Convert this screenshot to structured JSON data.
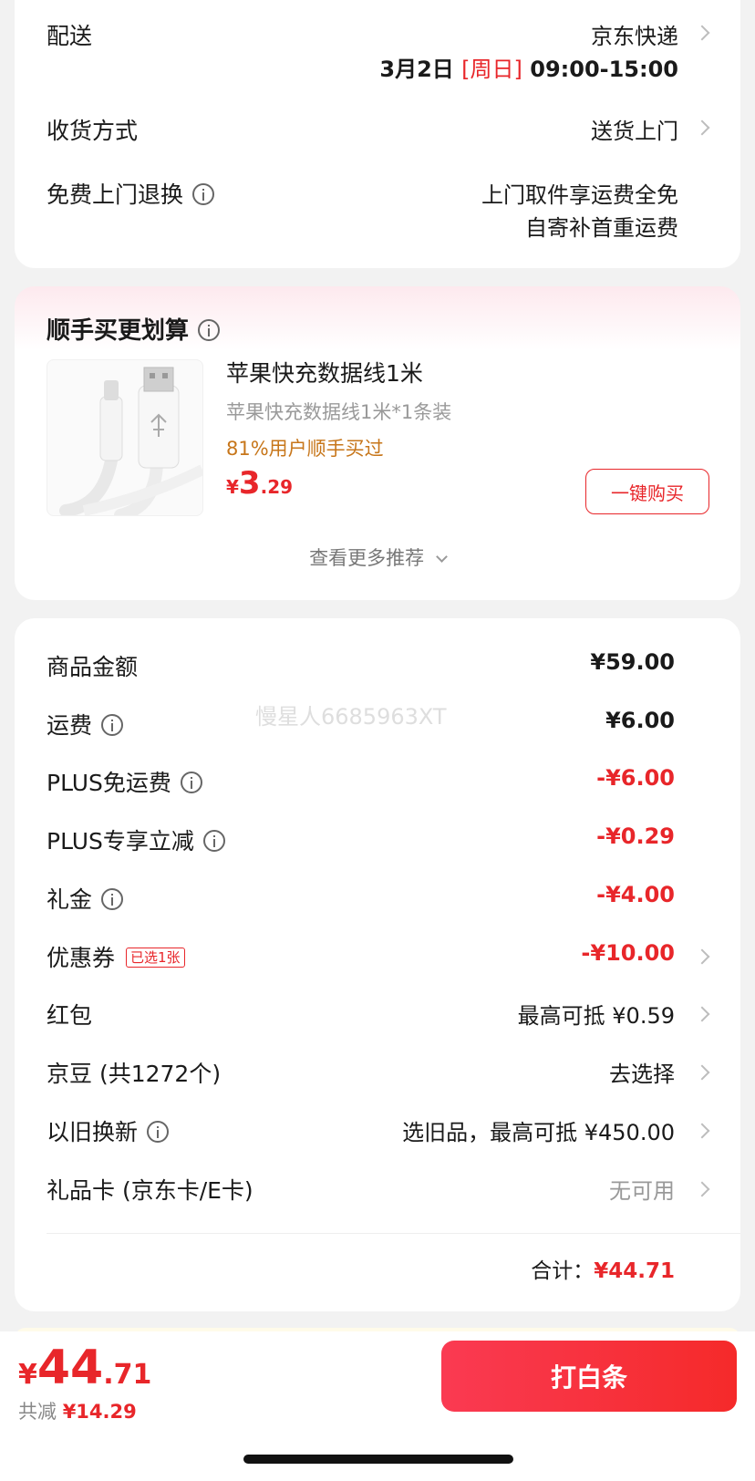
{
  "delivery": {
    "label": "配送",
    "carrier": "京东快递",
    "date": "3月2日",
    "weekday": "[周日]",
    "time": "09:00-15:00",
    "method_label": "收货方式",
    "method_value": "送货上门",
    "return_label": "免费上门退换",
    "return_line1": "上门取件享运费全免",
    "return_line2": "自寄补首重运费"
  },
  "addon": {
    "title": "顺手买更划算",
    "product_name": "苹果快充数据线1米",
    "product_spec": "苹果快充数据线1米*1条装",
    "buy_rate": "81%用户顺手买过",
    "price_symbol": "¥",
    "price_int": "3",
    "price_dec": ".29",
    "buy_button": "一键购买",
    "more": "查看更多推荐"
  },
  "summary": {
    "watermark": "慢星人6685963XT",
    "rows": [
      {
        "label": "商品金额",
        "value": "¥59.00"
      },
      {
        "label": "运费",
        "value": "¥6.00"
      },
      {
        "label": "PLUS免运费",
        "value": "-¥6.00"
      },
      {
        "label": "PLUS专享立减",
        "value": "-¥0.29"
      },
      {
        "label": "礼金",
        "value": "-¥4.00"
      },
      {
        "label": "优惠券",
        "badge": "已选1张",
        "value": "-¥10.00"
      },
      {
        "label": "红包",
        "value": "最高可抵 ¥0.59"
      },
      {
        "label": "京豆 (共1272个)",
        "value": "去选择"
      },
      {
        "label": "以旧换新",
        "value": "选旧品，最高可抵 ¥450.00"
      },
      {
        "label": "礼品卡 (京东卡/E卡)",
        "value": "无可用"
      }
    ],
    "total_label": "合计：",
    "total_value": "¥44.71"
  },
  "bottom_bar": {
    "price_symbol": "¥",
    "price_int": "44",
    "price_dec": ".71",
    "saved_label": "共减",
    "saved_value": "¥14.29",
    "pay_button": "打白条"
  },
  "colors": {
    "accent": "#e8262a",
    "orange": "#c7761a",
    "button": "#f52a2a"
  }
}
